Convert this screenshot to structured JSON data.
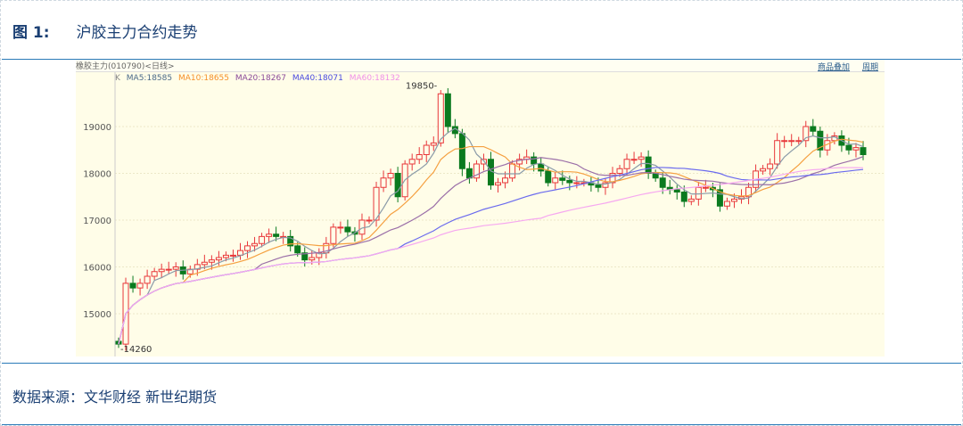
{
  "figure": {
    "label": "图 1:",
    "title": "沪胶主力合约走势"
  },
  "source": "数据来源：文华财经  新世纪期货",
  "chart_header": {
    "name": "橡胶主力",
    "code": "(010790)",
    "period": "<日线>",
    "overlay_link": "商品叠加",
    "cycle_link": "周期"
  },
  "legend": {
    "k": "K",
    "ma5": "MA5:18585",
    "ma10": "MA10:18655",
    "ma20": "MA20:18267",
    "ma40": "MA40:18071",
    "ma60": "MA60:18132"
  },
  "colors": {
    "up": "#e8373a",
    "down": "#0b7a1f",
    "ma5": "#8a9aa8",
    "ma10": "#f5a040",
    "ma20": "#9b6fa8",
    "ma40": "#6a6aee",
    "ma60": "#f6a8f0"
  },
  "chart_data": {
    "type": "candlestick",
    "ylim": [
      14100,
      20000
    ],
    "yticks": [
      15000,
      16000,
      17000,
      18000,
      19000
    ],
    "annotations": {
      "high": "19850",
      "low": "14260"
    },
    "closes": [
      14350,
      15650,
      15550,
      15650,
      15800,
      15900,
      15950,
      15950,
      16000,
      15850,
      15950,
      16050,
      16100,
      16150,
      16200,
      16250,
      16250,
      16350,
      16450,
      16500,
      16650,
      16700,
      16650,
      16650,
      16450,
      16300,
      16150,
      16200,
      16300,
      16500,
      16850,
      16850,
      16750,
      16700,
      17000,
      17000,
      17700,
      17900,
      18000,
      17500,
      18200,
      18300,
      18400,
      18600,
      18650,
      19700,
      19000,
      18850,
      18100,
      17900,
      18200,
      18300,
      17750,
      17800,
      17900,
      18200,
      18300,
      18350,
      18200,
      18050,
      17800,
      17900,
      17850,
      17800,
      17800,
      17800,
      17750,
      17700,
      17800,
      18000,
      18100,
      18300,
      18300,
      18350,
      18000,
      17900,
      17700,
      17650,
      17600,
      17400,
      17450,
      17700,
      17700,
      17650,
      17300,
      17400,
      17450,
      17500,
      17700,
      18050,
      18100,
      18200,
      18700,
      18700,
      18700,
      18700,
      19000,
      18900,
      18500,
      18700,
      18800,
      18600,
      18500,
      18550,
      18400
    ]
  }
}
